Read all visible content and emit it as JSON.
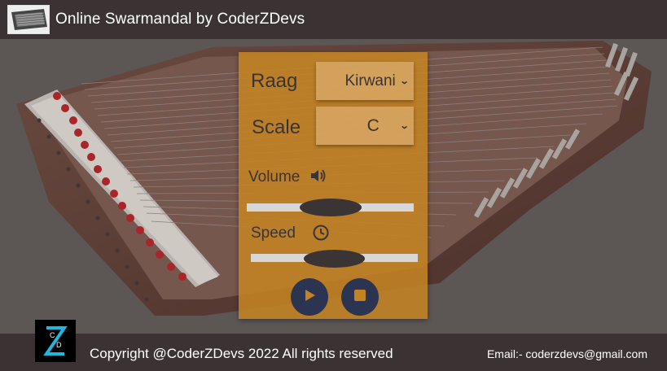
{
  "header": {
    "title": "Online Swarmandal by CoderZDevs"
  },
  "controls": {
    "raag": {
      "label": "Raag",
      "value": "Kirwani"
    },
    "scale": {
      "label": "Scale",
      "value": "C"
    },
    "volume": {
      "label": "Volume",
      "icon": "speaker-icon",
      "level": 0.5
    },
    "speed": {
      "label": "Speed",
      "icon": "clock-icon",
      "level": 0.5
    },
    "play_icon": "play-icon",
    "stop_icon": "stop-icon"
  },
  "footer": {
    "logo_text": "ZD",
    "copyright": "Copyright @CoderZDevs 2022 All rights reserved",
    "email": "Email:- coderzdevs@gmail.com"
  },
  "colors": {
    "header_bg": "#3b3333",
    "panel_bg": "#c48323",
    "button_bg": "#2b3552",
    "logo_accent": "#1fb6e0"
  }
}
